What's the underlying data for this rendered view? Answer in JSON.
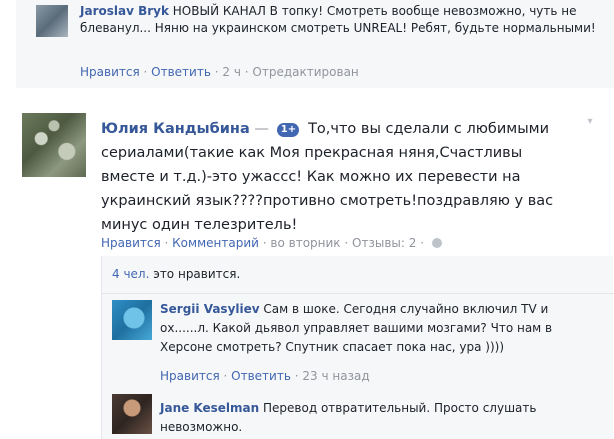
{
  "comment_top": {
    "author": "Jaroslav Bryk",
    "text": "НОВЫЙ КАНАЛ В топку! Смотреть вообще невозможно, чуть не блеванул... Няню на украинском смотреть UNREAL! Ребят, будьте нормальными!",
    "like_label": "Нравится",
    "reply_label": "Ответить",
    "time": "2 ч",
    "edited_label": "Отредактирован",
    "sep": "·"
  },
  "comment_main": {
    "author": "Юлия Кандыбина",
    "dash": "—",
    "badge": "1+",
    "text": "То,что вы сделали с любимыми сериалами(такие как Моя прекрасная няня,Счастливы вместе и т.д.)-это ужассс! Как можно их перевести на украинский язык????противно смотреть!поздравляю у вас минус один телезритель!",
    "like_label": "Нравится",
    "comment_label": "Комментарий",
    "time": "во вторник",
    "reviews_label": "Отзывы: 2",
    "sep": "·",
    "globe_icon": "globe-icon",
    "chevron_icon": "chevron-down-icon"
  },
  "replies": {
    "likes_count": "4 чел.",
    "likes_suffix": "это нравится.",
    "items": [
      {
        "author": "Sergii Vasyliev",
        "text": "Сам в шоке. Сегодня случайно включил TV и ох......л. Какой дьявол управляет вашими мозгами? Что нам в Херсоне смотреть? Спутник спасает пока нас, ура ))))",
        "like_label": "Нравится",
        "reply_label": "Ответить",
        "time": "23 ч назад",
        "sep": "·"
      },
      {
        "author": "Jane Keselman",
        "text": "Перевод отвратительный. Просто слушать невозможно."
      }
    ]
  }
}
